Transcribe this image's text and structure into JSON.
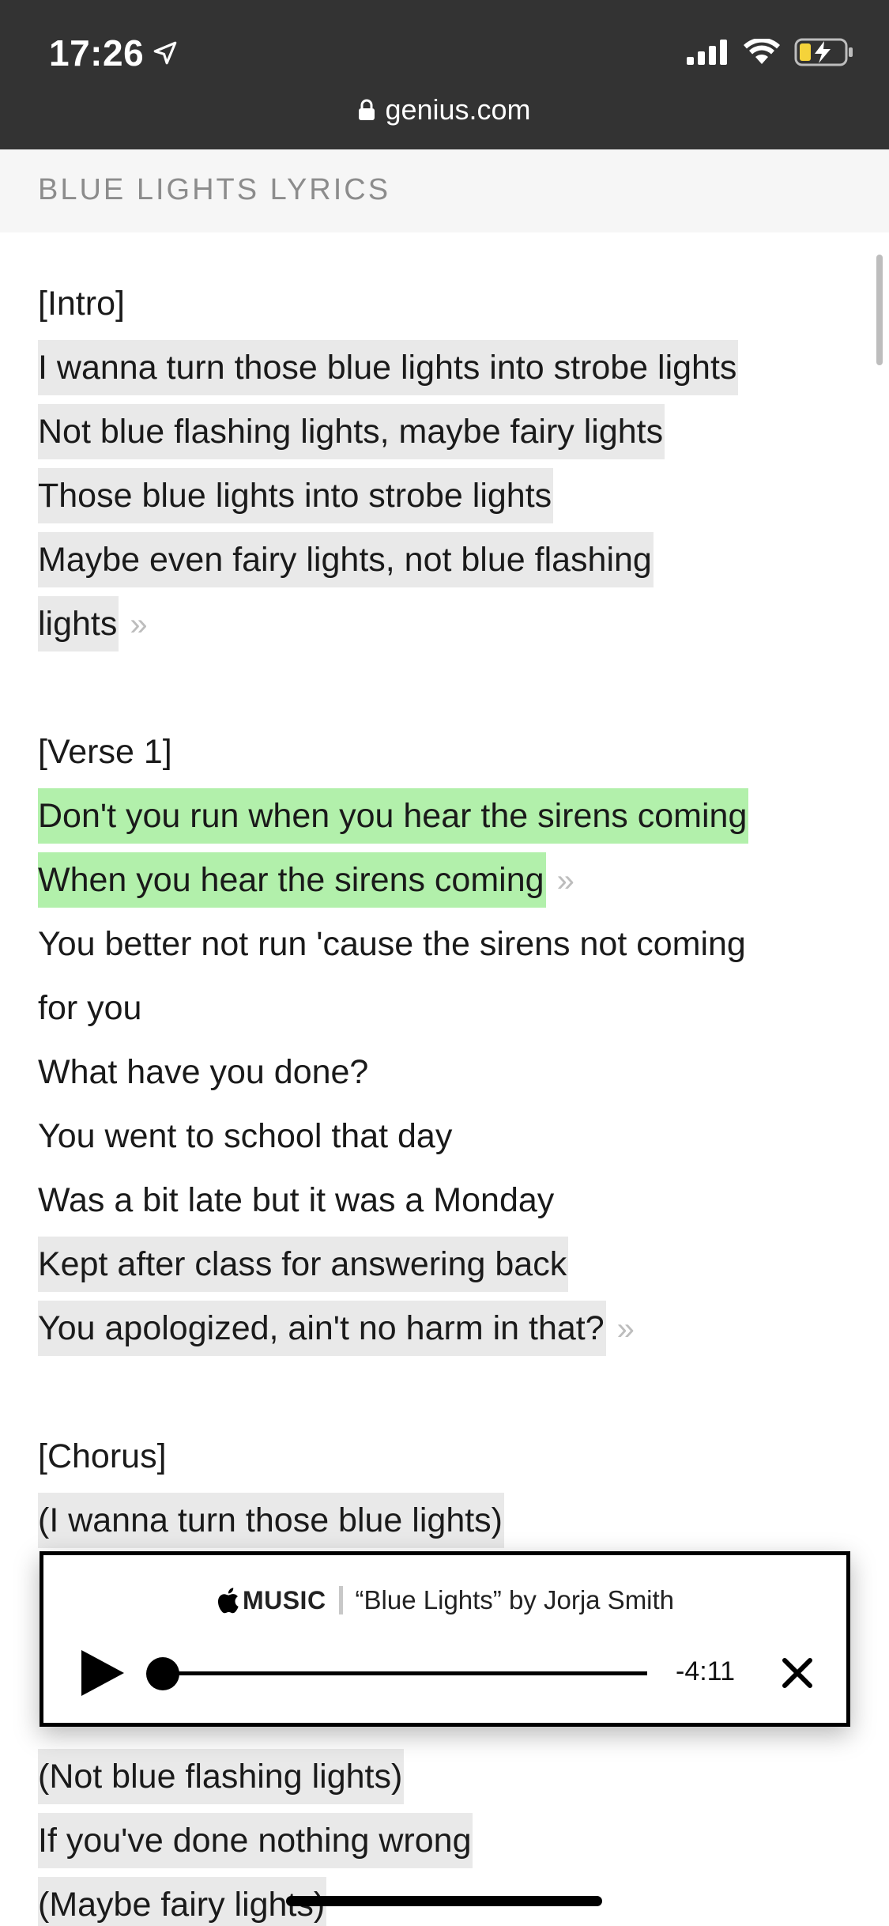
{
  "status_bar": {
    "time": "17:26",
    "battery_color": "#f5d33a"
  },
  "browser": {
    "url": "genius.com"
  },
  "section_title": "BLUE LIGHTS LYRICS",
  "lyrics": [
    {
      "text": "[Intro]",
      "hl": "none",
      "more": false
    },
    {
      "text": "I wanna turn those blue lights into strobe lights",
      "hl": "grey",
      "more": false
    },
    {
      "text": "Not blue flashing lights, maybe fairy lights",
      "hl": "grey",
      "more": false
    },
    {
      "text": "Those blue lights into strobe lights",
      "hl": "grey",
      "more": false
    },
    {
      "text": "Maybe even fairy lights, not blue flashing",
      "hl": "grey",
      "more": false
    },
    {
      "text": "lights",
      "hl": "grey",
      "more": true
    },
    {
      "text": "",
      "hl": "gap",
      "more": false
    },
    {
      "text": "[Verse 1]",
      "hl": "none",
      "more": false
    },
    {
      "text": "Don't you run when you hear the sirens coming",
      "hl": "green",
      "more": false
    },
    {
      "text": "When you hear the sirens coming",
      "hl": "green",
      "more": true
    },
    {
      "text": "You better not run 'cause the sirens not coming",
      "hl": "none",
      "more": false
    },
    {
      "text": "for you",
      "hl": "none",
      "more": false
    },
    {
      "text": "What have you done?",
      "hl": "none",
      "more": false
    },
    {
      "text": "You went to school that day",
      "hl": "none",
      "more": false
    },
    {
      "text": "Was a bit late but it was a Monday",
      "hl": "none",
      "more": false
    },
    {
      "text": "Kept after class for answering back",
      "hl": "grey",
      "more": false
    },
    {
      "text": "You apologized, ain't no harm in that?",
      "hl": "grey",
      "more": true
    },
    {
      "text": "",
      "hl": "gap",
      "more": false
    },
    {
      "text": "[Chorus]",
      "hl": "none",
      "more": false
    },
    {
      "text": "(I wanna turn those blue lights)",
      "hl": "grey",
      "more": false
    },
    {
      "text": "",
      "hl": "grey-hidden",
      "more": false
    },
    {
      "text": "",
      "hl": "grey-hidden",
      "more": false
    },
    {
      "text": "",
      "hl": "grey-hidden",
      "more": false
    },
    {
      "text": "(Not blue flashing lights)",
      "hl": "grey",
      "more": false
    },
    {
      "text": "If you've done nothing wrong",
      "hl": "grey",
      "more": false
    },
    {
      "text": "(Maybe fairy lights)",
      "hl": "grey",
      "more": false
    }
  ],
  "more_glyph": "»",
  "player": {
    "brand": "MUSIC",
    "track": "“Blue Lights” by Jorja Smith",
    "remaining": "-4:11",
    "progress": 0.0
  }
}
